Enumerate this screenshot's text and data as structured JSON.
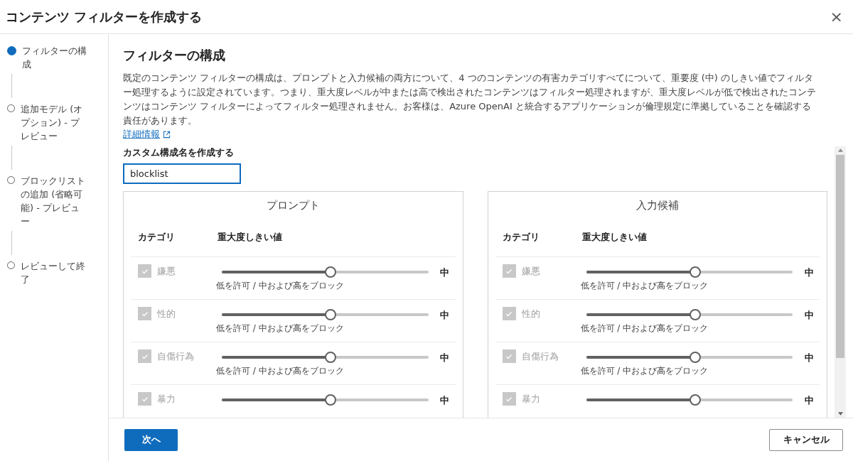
{
  "dialog": {
    "title": "コンテンツ フィルターを作成する",
    "close": "×"
  },
  "steps": [
    {
      "label": "フィルターの構成",
      "selected": true
    },
    {
      "label": "追加モデル (オプション) - プレビュー",
      "selected": false
    },
    {
      "label": "ブロックリストの追加 (省略可能) - プレビュー",
      "selected": false
    },
    {
      "label": "レビューして終了",
      "selected": false
    }
  ],
  "section": {
    "title": "フィルターの構成",
    "description": "既定のコンテンツ フィルターの構成は、プロンプトと入力候補の両方について、4 つのコンテンツの有害カテゴリすべてについて、重要度 (中) のしきい値でフィルター処理するように設定されています。つまり、重大度レベルが中または高で検出されたコンテンツはフィルター処理されますが、重大度レベルが低で検出されたコンテンツはコンテンツ フィルターによってフィルター処理されません。お客様は、Azure OpenAI と統合するアプリケーションが倫理規定に準拠していることを確認する責任があります。",
    "link": "詳細情報"
  },
  "name_field": {
    "label": "カスタム構成名を作成する",
    "value": "blocklist"
  },
  "panels": [
    {
      "title": "プロンプト",
      "columns": [
        "カテゴリ",
        "重大度しきい値"
      ],
      "rows": [
        {
          "category": "嫌悪",
          "checked": true,
          "disabled": true,
          "level": 0.5,
          "reading": "中",
          "hint": "低を許可 / 中および高をブロック"
        },
        {
          "category": "性的",
          "checked": true,
          "disabled": true,
          "level": 0.5,
          "reading": "中",
          "hint": "低を許可 / 中および高をブロック"
        },
        {
          "category": "自傷行為",
          "checked": true,
          "disabled": true,
          "level": 0.5,
          "reading": "中",
          "hint": "低を許可 / 中および高をブロック"
        },
        {
          "category": "暴力",
          "checked": true,
          "disabled": true,
          "level": 0.5,
          "reading": "中"
        }
      ]
    },
    {
      "title": "入力候補",
      "columns": [
        "カテゴリ",
        "重大度しきい値"
      ],
      "rows": [
        {
          "category": "嫌悪",
          "checked": true,
          "disabled": true,
          "level": 0.5,
          "reading": "中",
          "hint": "低を許可 / 中および高をブロック"
        },
        {
          "category": "性的",
          "checked": true,
          "disabled": true,
          "level": 0.5,
          "reading": "中",
          "hint": "低を許可 / 中および高をブロック"
        },
        {
          "category": "自傷行為",
          "checked": true,
          "disabled": true,
          "level": 0.5,
          "reading": "中",
          "hint": "低を許可 / 中および高をブロック"
        },
        {
          "category": "暴力",
          "checked": true,
          "disabled": true,
          "level": 0.5,
          "reading": "中"
        }
      ]
    }
  ],
  "footer": {
    "next": "次へ",
    "cancel": "キャンセル"
  }
}
